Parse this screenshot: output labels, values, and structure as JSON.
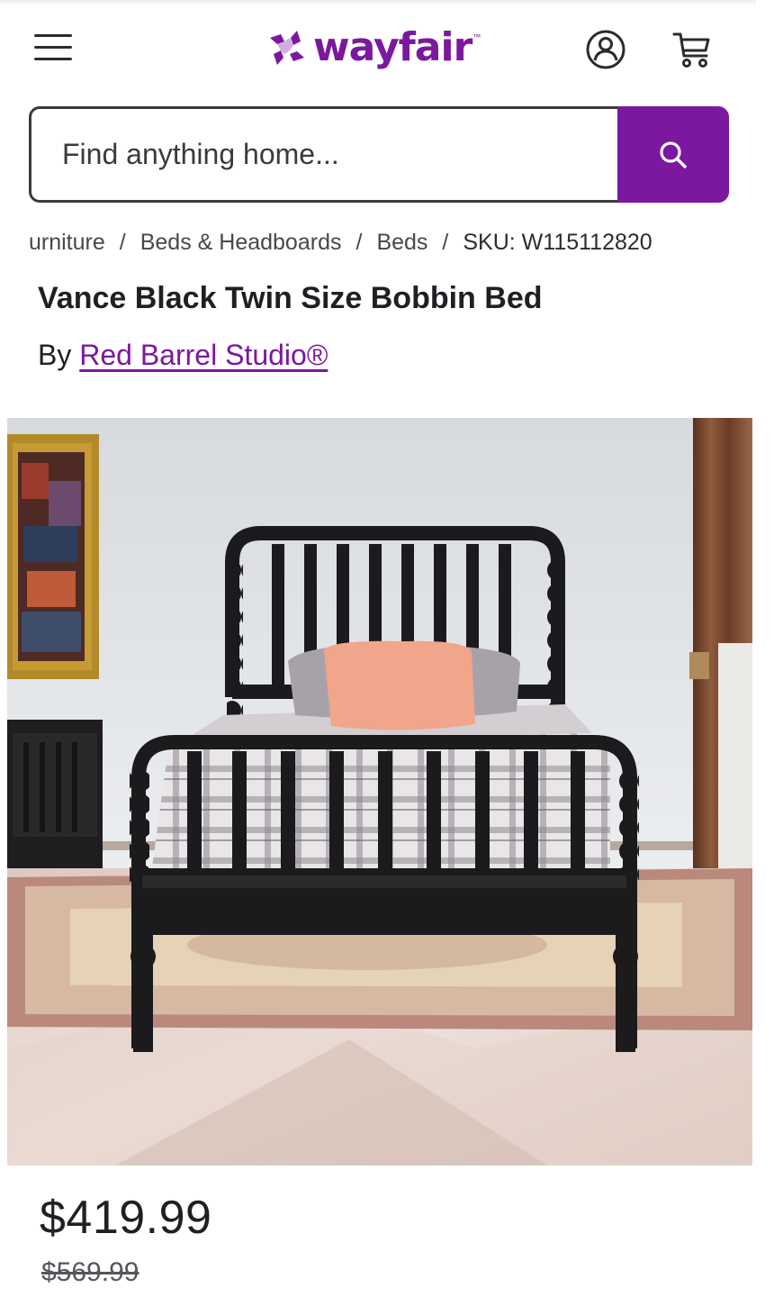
{
  "header": {
    "menu_icon": "hamburger-menu-icon",
    "logo_text": "wayfair",
    "logo_tm": "™",
    "account_icon": "account-icon",
    "cart_icon": "cart-icon",
    "brand_color": "#7b189f"
  },
  "search": {
    "placeholder": "Find anything home...",
    "button_icon": "search-icon"
  },
  "breadcrumb": {
    "items": [
      "urniture",
      "Beds & Headboards",
      "Beds"
    ],
    "separator": "/",
    "sku": "SKU: W115112820"
  },
  "product": {
    "title": "Vance Black Twin Size Bobbin Bed",
    "by_label": "By",
    "brand": "Red Barrel Studio®",
    "image_alt": "black bobbin twin bed in bedroom",
    "price": "$419.99",
    "was_price": "$569.99"
  }
}
